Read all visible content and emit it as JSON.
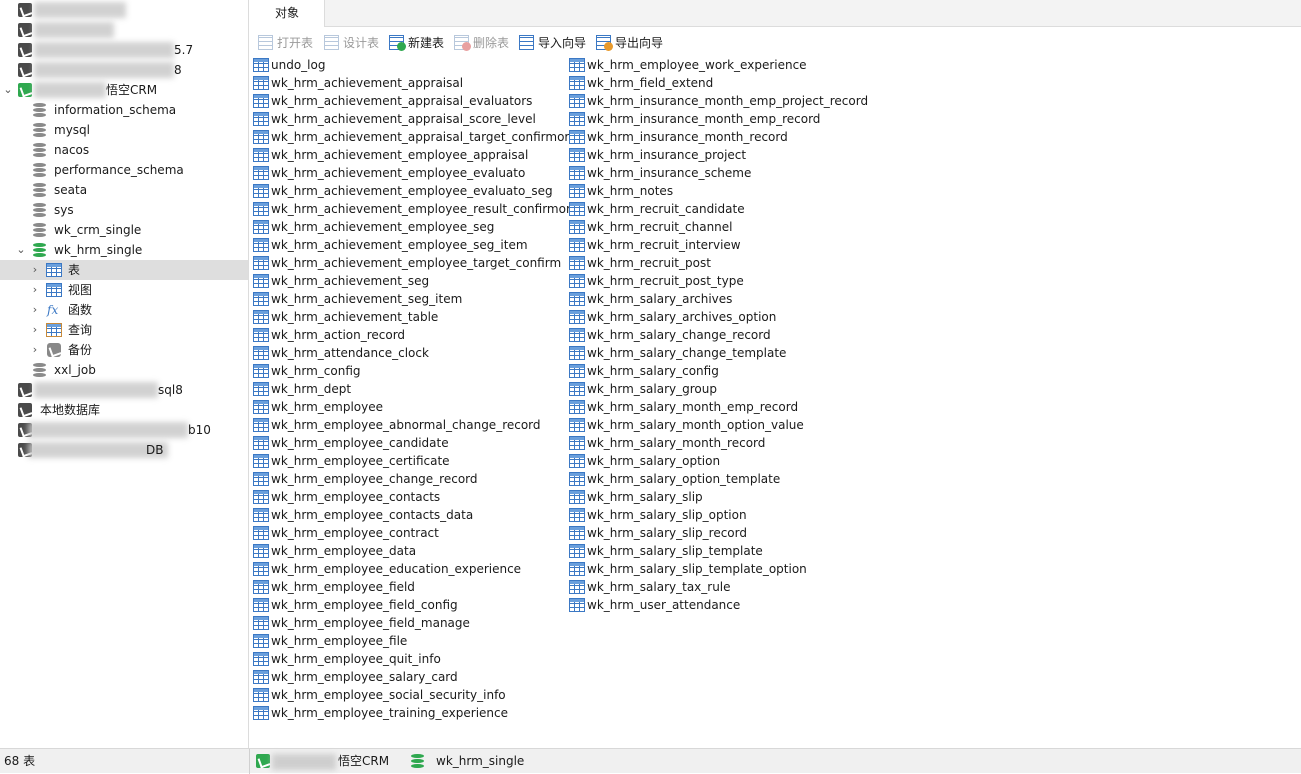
{
  "tree": {
    "connections_top": [
      "",
      "",
      "",
      ""
    ],
    "conn_suffixes": [
      "",
      "",
      "5.7",
      "8"
    ],
    "open_connection_suffix": "悟空CRM",
    "databases": [
      "information_schema",
      "mysql",
      "nacos",
      "performance_schema",
      "seata",
      "sys",
      "wk_crm_single",
      "wk_hrm_single"
    ],
    "hrm_children": [
      "表",
      "视图",
      "函数",
      "查询",
      "备份"
    ],
    "after": [
      "xxl_job"
    ],
    "conn_bottom_suffixes": [
      "sql8",
      "",
      "b10",
      "DB"
    ],
    "local_db": "本地数据库"
  },
  "tabs": {
    "objects": "对象"
  },
  "toolbar": {
    "open_table": "打开表",
    "design_table": "设计表",
    "new_table": "新建表",
    "delete_table": "删除表",
    "import_wizard": "导入向导",
    "export_wizard": "导出向导"
  },
  "tables_col1": [
    "undo_log",
    "wk_hrm_achievement_appraisal",
    "wk_hrm_achievement_appraisal_evaluators",
    "wk_hrm_achievement_appraisal_score_level",
    "wk_hrm_achievement_appraisal_target_confirmors",
    "wk_hrm_achievement_employee_appraisal",
    "wk_hrm_achievement_employee_evaluato",
    "wk_hrm_achievement_employee_evaluato_seg",
    "wk_hrm_achievement_employee_result_confirmors",
    "wk_hrm_achievement_employee_seg",
    "wk_hrm_achievement_employee_seg_item",
    "wk_hrm_achievement_employee_target_confirm",
    "wk_hrm_achievement_seg",
    "wk_hrm_achievement_seg_item",
    "wk_hrm_achievement_table",
    "wk_hrm_action_record",
    "wk_hrm_attendance_clock",
    "wk_hrm_config",
    "wk_hrm_dept",
    "wk_hrm_employee",
    "wk_hrm_employee_abnormal_change_record",
    "wk_hrm_employee_candidate",
    "wk_hrm_employee_certificate",
    "wk_hrm_employee_change_record",
    "wk_hrm_employee_contacts",
    "wk_hrm_employee_contacts_data",
    "wk_hrm_employee_contract",
    "wk_hrm_employee_data",
    "wk_hrm_employee_education_experience",
    "wk_hrm_employee_field",
    "wk_hrm_employee_field_config",
    "wk_hrm_employee_field_manage",
    "wk_hrm_employee_file",
    "wk_hrm_employee_quit_info",
    "wk_hrm_employee_salary_card",
    "wk_hrm_employee_social_security_info",
    "wk_hrm_employee_training_experience"
  ],
  "tables_col2": [
    "wk_hrm_employee_work_experience",
    "wk_hrm_field_extend",
    "wk_hrm_insurance_month_emp_project_record",
    "wk_hrm_insurance_month_emp_record",
    "wk_hrm_insurance_month_record",
    "wk_hrm_insurance_project",
    "wk_hrm_insurance_scheme",
    "wk_hrm_notes",
    "wk_hrm_recruit_candidate",
    "wk_hrm_recruit_channel",
    "wk_hrm_recruit_interview",
    "wk_hrm_recruit_post",
    "wk_hrm_recruit_post_type",
    "wk_hrm_salary_archives",
    "wk_hrm_salary_archives_option",
    "wk_hrm_salary_change_record",
    "wk_hrm_salary_change_template",
    "wk_hrm_salary_config",
    "wk_hrm_salary_group",
    "wk_hrm_salary_month_emp_record",
    "wk_hrm_salary_month_option_value",
    "wk_hrm_salary_month_record",
    "wk_hrm_salary_option",
    "wk_hrm_salary_option_template",
    "wk_hrm_salary_slip",
    "wk_hrm_salary_slip_option",
    "wk_hrm_salary_slip_record",
    "wk_hrm_salary_slip_template",
    "wk_hrm_salary_slip_template_option",
    "wk_hrm_salary_tax_rule",
    "wk_hrm_user_attendance"
  ],
  "status": {
    "count": "68 表",
    "connection_suffix": "悟空CRM",
    "database": "wk_hrm_single"
  },
  "colors": {
    "accent_green": "#2fa84f",
    "table_blue": "#3b78c4",
    "selection": "#dedede"
  }
}
